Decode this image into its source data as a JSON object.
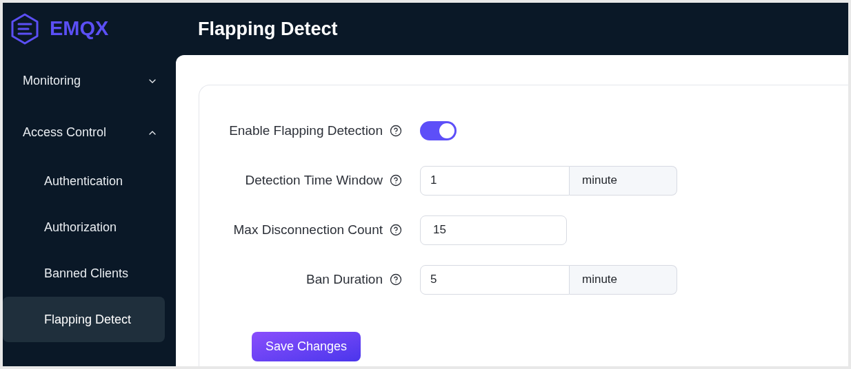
{
  "brand": {
    "name": "EMQX"
  },
  "page_title": "Flapping Detect",
  "sidebar": {
    "items": [
      {
        "label": "Monitoring",
        "expanded": false
      },
      {
        "label": "Access Control",
        "expanded": true,
        "children": [
          {
            "label": "Authentication",
            "selected": false
          },
          {
            "label": "Authorization",
            "selected": false
          },
          {
            "label": "Banned Clients",
            "selected": false
          },
          {
            "label": "Flapping Detect",
            "selected": true
          }
        ]
      }
    ]
  },
  "form": {
    "fields": [
      {
        "kind": "switch",
        "label": "Enable Flapping Detection",
        "on": true
      },
      {
        "kind": "input_unit",
        "label": "Detection Time Window",
        "value": "1",
        "unit": "minute"
      },
      {
        "kind": "input",
        "label": "Max Disconnection Count",
        "value": "15"
      },
      {
        "kind": "input_unit",
        "label": "Ban Duration",
        "value": "5",
        "unit": "minute"
      }
    ],
    "submit": "Save Changes"
  }
}
